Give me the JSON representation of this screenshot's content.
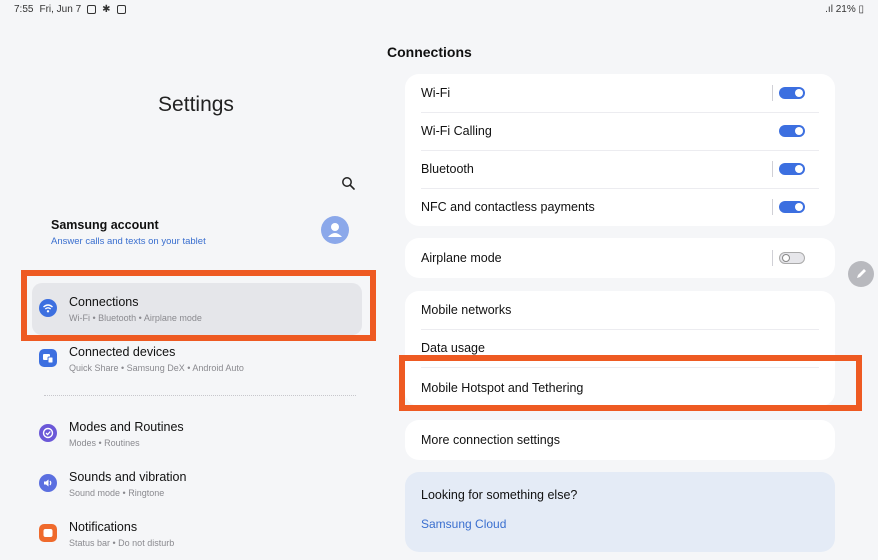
{
  "status_bar": {
    "time": "7:55",
    "date": "Fri, Jun 7",
    "battery": "21%"
  },
  "left": {
    "title": "Settings",
    "account": {
      "name": "Samsung account",
      "subtitle": "Answer calls and texts on your tablet"
    },
    "items": [
      {
        "title": "Connections",
        "subtitle": "Wi-Fi • Bluetooth • Airplane mode",
        "icon": "wifi-icon",
        "color": "#3c6fe0"
      },
      {
        "title": "Connected devices",
        "subtitle": "Quick Share • Samsung DeX • Android Auto",
        "icon": "devices-icon",
        "color": "#3c6fe0"
      },
      {
        "title": "Modes and Routines",
        "subtitle": "Modes • Routines",
        "icon": "modes-icon",
        "color": "#6b58d8"
      },
      {
        "title": "Sounds and vibration",
        "subtitle": "Sound mode • Ringtone",
        "icon": "sound-icon",
        "color": "#5b6fe0"
      },
      {
        "title": "Notifications",
        "subtitle": "Status bar • Do not disturb",
        "icon": "notifications-icon",
        "color": "#ef6a2c"
      }
    ]
  },
  "right": {
    "title": "Connections",
    "toggles": [
      {
        "label": "Wi-Fi",
        "on": true
      },
      {
        "label": "Wi-Fi Calling",
        "on": true
      },
      {
        "label": "Bluetooth",
        "on": true
      },
      {
        "label": "NFC and contactless payments",
        "on": true
      }
    ],
    "airplane": {
      "label": "Airplane mode",
      "on": false
    },
    "network_items": [
      "Mobile networks",
      "Data usage",
      "Mobile Hotspot and Tethering"
    ],
    "more": "More connection settings",
    "looking": {
      "title": "Looking for something else?",
      "link": "Samsung Cloud"
    }
  },
  "colors": {
    "accent": "#3c6fe0",
    "highlight": "#ee5a22"
  }
}
